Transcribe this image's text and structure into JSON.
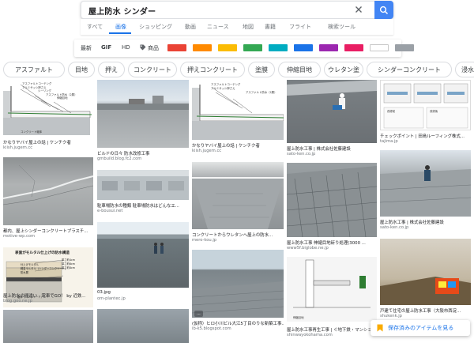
{
  "search": {
    "query": "屋上防水 シンダー",
    "clear_icon": "close-icon",
    "search_icon": "search-icon"
  },
  "tabs": [
    {
      "label": "すべて",
      "active": false
    },
    {
      "label": "画像",
      "active": true
    },
    {
      "label": "ショッピング",
      "active": false
    },
    {
      "label": "動画",
      "active": false
    },
    {
      "label": "ニュース",
      "active": false
    },
    {
      "label": "地図",
      "active": false
    },
    {
      "label": "書籍",
      "active": false
    },
    {
      "label": "フライト",
      "active": false
    },
    {
      "label": "検索ツール",
      "active": false
    }
  ],
  "filters": {
    "latest": "最新",
    "gif": "GIF",
    "hd": "HD",
    "products": "商品",
    "color_swatches": [
      "#ea4335",
      "#ff8a00",
      "#fbbc04",
      "#34a853",
      "#00acc1",
      "#1a73e8",
      "#9c27b0",
      "#e91e63",
      "#ffffff",
      "#9aa0a6"
    ]
  },
  "chips": [
    "アスファルト",
    "目地",
    "押え",
    "コンクリート",
    "押えコンクリート",
    "塗膜",
    "伸縮目地",
    "ウレタン塗",
    "シンダーコンクリート",
    "浸水",
    "アス"
  ],
  "results": [
    {
      "caption": "かなりヤバイ屋上の話 | ケンチク者",
      "source": "kiish.jugem.cc"
    },
    {
      "caption": "ビルドの日々 防水改修工事",
      "source": "gmbuild.blog.fc2.com"
    },
    {
      "caption": "かなりヤバイ屋上の話 | ケンチク者",
      "source": "kiish.jugem.cc"
    },
    {
      "caption": "屋上防水工事 | 株式会社佐藤建設",
      "source": "sato-ken.co.jp"
    },
    {
      "caption": "チェックポイント | 田島ルーフィング株式...",
      "source": "tajima.jp"
    },
    {
      "caption": "駐車場防水の種類 駐車場防水はどんなエ...",
      "source": "e-bousui.net"
    },
    {
      "caption": "コンクリートからウレタンへ屋上の防水...",
      "source": "mero-kou.jp"
    },
    {
      "caption": "都内、屋上シンダーコンクリートプラスチ...",
      "source": "motive-wp.com"
    },
    {
      "caption": "屋上防水工事 伸縮目地斫り処理(3000 ...",
      "source": "www5f.biglobe.ne.jp"
    },
    {
      "caption": "屋上防水工事 | 株式会社佐藤建設",
      "source": "sato-ken.co.jp"
    },
    {
      "caption": "03.jpg",
      "source": "om-plantec.jp"
    },
    {
      "caption": "屋上防水の間違い - 電車でGO！ by 近鉄...",
      "source": "blog.goo.ne.jp"
    },
    {
      "caption": "(仮称）ヒロ小川ビル大江5丁目のりな新築工事...",
      "source": "ib-k5.blogspot.com"
    },
    {
      "caption": "屋上防水工事再生工事 | ぐ地下鉄・マンショ...",
      "source": "shinwayokohama.com"
    },
    {
      "caption": "戸建て住宅の屋上防水工事（大阪市西淀...",
      "source": "shukenk.jp"
    }
  ],
  "image_labels": {
    "wall_layers": [
      "アスファルトコーテング",
      "アルミサッシ押さえ",
      "シーリング",
      "アスファルト防水（2層）",
      "伸縮目地",
      "コンクリート躯体"
    ],
    "wall_layers_b": [
      "アスファルトコーテング",
      "アルミサッシ押さえ",
      "アスファルト防水（2層）"
    ],
    "tajima_mini": [
      "改修前",
      "改修後"
    ],
    "mortar_title": "表面がモルタル仕上げの防水構造",
    "mortar_layers": [
      "厚さ約4cm",
      "仕上げモルタル",
      "厚さ約6cm",
      "軽量モルタル（シンダーコンクリート）",
      "厚さ約8cm",
      "防水層",
      "躯体（コンクリート）"
    ],
    "wall_c": [
      "伸縮目地",
      "防水層"
    ]
  },
  "saved_toast": {
    "label": "保存済みのアイテムを見る",
    "icon": "bookmark-icon"
  }
}
